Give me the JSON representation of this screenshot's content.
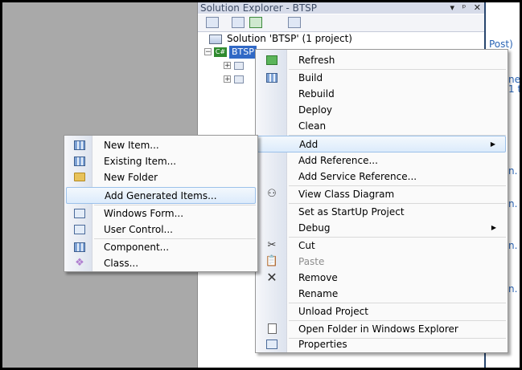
{
  "solution_explorer": {
    "title": "Solution Explorer - BTSP",
    "title_buttons": [
      "▾",
      "ᵖ",
      "✕"
    ],
    "tree": {
      "solution_label": "Solution 'BTSP' (1 project)",
      "project_label": "BTSP",
      "project_icon_text": "C#",
      "child_expanders": [
        "+",
        "+"
      ]
    }
  },
  "right_pane": {
    "fragments": [
      "Post)",
      "ne",
      "1 t",
      "n.",
      "n.",
      "n.",
      "n."
    ]
  },
  "context_menu": {
    "items": [
      {
        "label": "Refresh",
        "icon": "refresh-icon"
      },
      {
        "label": "Build",
        "icon": "build-icon"
      },
      {
        "label": "Rebuild"
      },
      {
        "label": "Deploy"
      },
      {
        "label": "Clean"
      },
      {
        "label": "Add",
        "has_submenu": true,
        "highlighted": true
      },
      {
        "label": "Add Reference..."
      },
      {
        "label": "Add Service Reference..."
      },
      {
        "label": "View Class Diagram",
        "icon": "class-diagram-icon"
      },
      {
        "label": "Set as StartUp Project"
      },
      {
        "label": "Debug",
        "has_submenu": true
      },
      {
        "label": "Cut",
        "icon": "scissors-icon"
      },
      {
        "label": "Paste",
        "icon": "paste-icon",
        "disabled": true
      },
      {
        "label": "Remove",
        "icon": "remove-x-icon"
      },
      {
        "label": "Rename"
      },
      {
        "label": "Unload Project"
      },
      {
        "label": "Open Folder in Windows Explorer",
        "icon": "open-folder-icon"
      },
      {
        "label": "Properties",
        "icon": "properties-icon"
      }
    ]
  },
  "add_submenu": {
    "items": [
      {
        "label": "New Item...",
        "icon": "new-item-icon"
      },
      {
        "label": "Existing Item...",
        "icon": "existing-item-icon"
      },
      {
        "label": "New Folder",
        "icon": "folder-icon"
      },
      {
        "label": "Add Generated Items...",
        "highlighted": true
      },
      {
        "label": "Windows Form...",
        "icon": "windows-form-icon"
      },
      {
        "label": "User Control...",
        "icon": "user-control-icon"
      },
      {
        "label": "Component...",
        "icon": "component-icon"
      },
      {
        "label": "Class...",
        "icon": "class-icon"
      }
    ]
  },
  "colors": {
    "selection_blue": "#3169c6",
    "menu_highlight_border": "#9cc1ea",
    "title_bar": "#d6dbe9",
    "background_gray": "#a9a9a9"
  }
}
